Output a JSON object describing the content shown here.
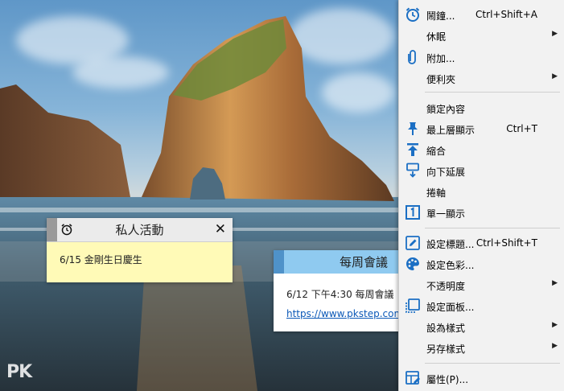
{
  "colors": {
    "menu_background": "#f2f2f2",
    "icon_blue": "#1b6fc4",
    "private_note": "#fffab7",
    "meeting_header": "#8fcaf0"
  },
  "desktop": {
    "watermark": "PK"
  },
  "notes": {
    "private": {
      "title": "私人活動",
      "body": "6/15 金剛生日慶生",
      "icons": [
        "alarm-icon",
        "close-icon"
      ]
    },
    "meeting": {
      "title": "每周會議",
      "body_line1": "6/12 下午4:30 每周會議",
      "link": "https://www.pkstep.com"
    }
  },
  "menu": {
    "items": [
      {
        "label": "鬧鐘...",
        "shortcut": "Ctrl+Shift+A",
        "icon": "alarm-clock-icon"
      },
      {
        "label": "休眠",
        "submenu": true
      },
      {
        "label": "附加...",
        "icon": "paperclip-icon"
      },
      {
        "label": "便利夾",
        "submenu": true
      },
      {
        "label": "鎖定內容"
      },
      {
        "label": "最上層顯示",
        "shortcut": "Ctrl+T",
        "icon": "pin-icon"
      },
      {
        "label": "縮合",
        "icon": "collapse-up-icon"
      },
      {
        "label": "向下延展",
        "icon": "expand-down-icon"
      },
      {
        "label": "捲軸"
      },
      {
        "label": "單一顯示",
        "icon": "single-view-icon"
      },
      {
        "label": "設定標題...",
        "shortcut": "Ctrl+Shift+T",
        "icon": "edit-pencil-icon"
      },
      {
        "label": "設定色彩...",
        "icon": "palette-icon"
      },
      {
        "label": "不透明度",
        "submenu": true
      },
      {
        "label": "設定面板...",
        "icon": "panel-icon"
      },
      {
        "label": "設為樣式",
        "submenu": true
      },
      {
        "label": "另存樣式",
        "submenu": true
      },
      {
        "label": "屬性(P)...",
        "icon": "properties-icon"
      }
    ]
  }
}
